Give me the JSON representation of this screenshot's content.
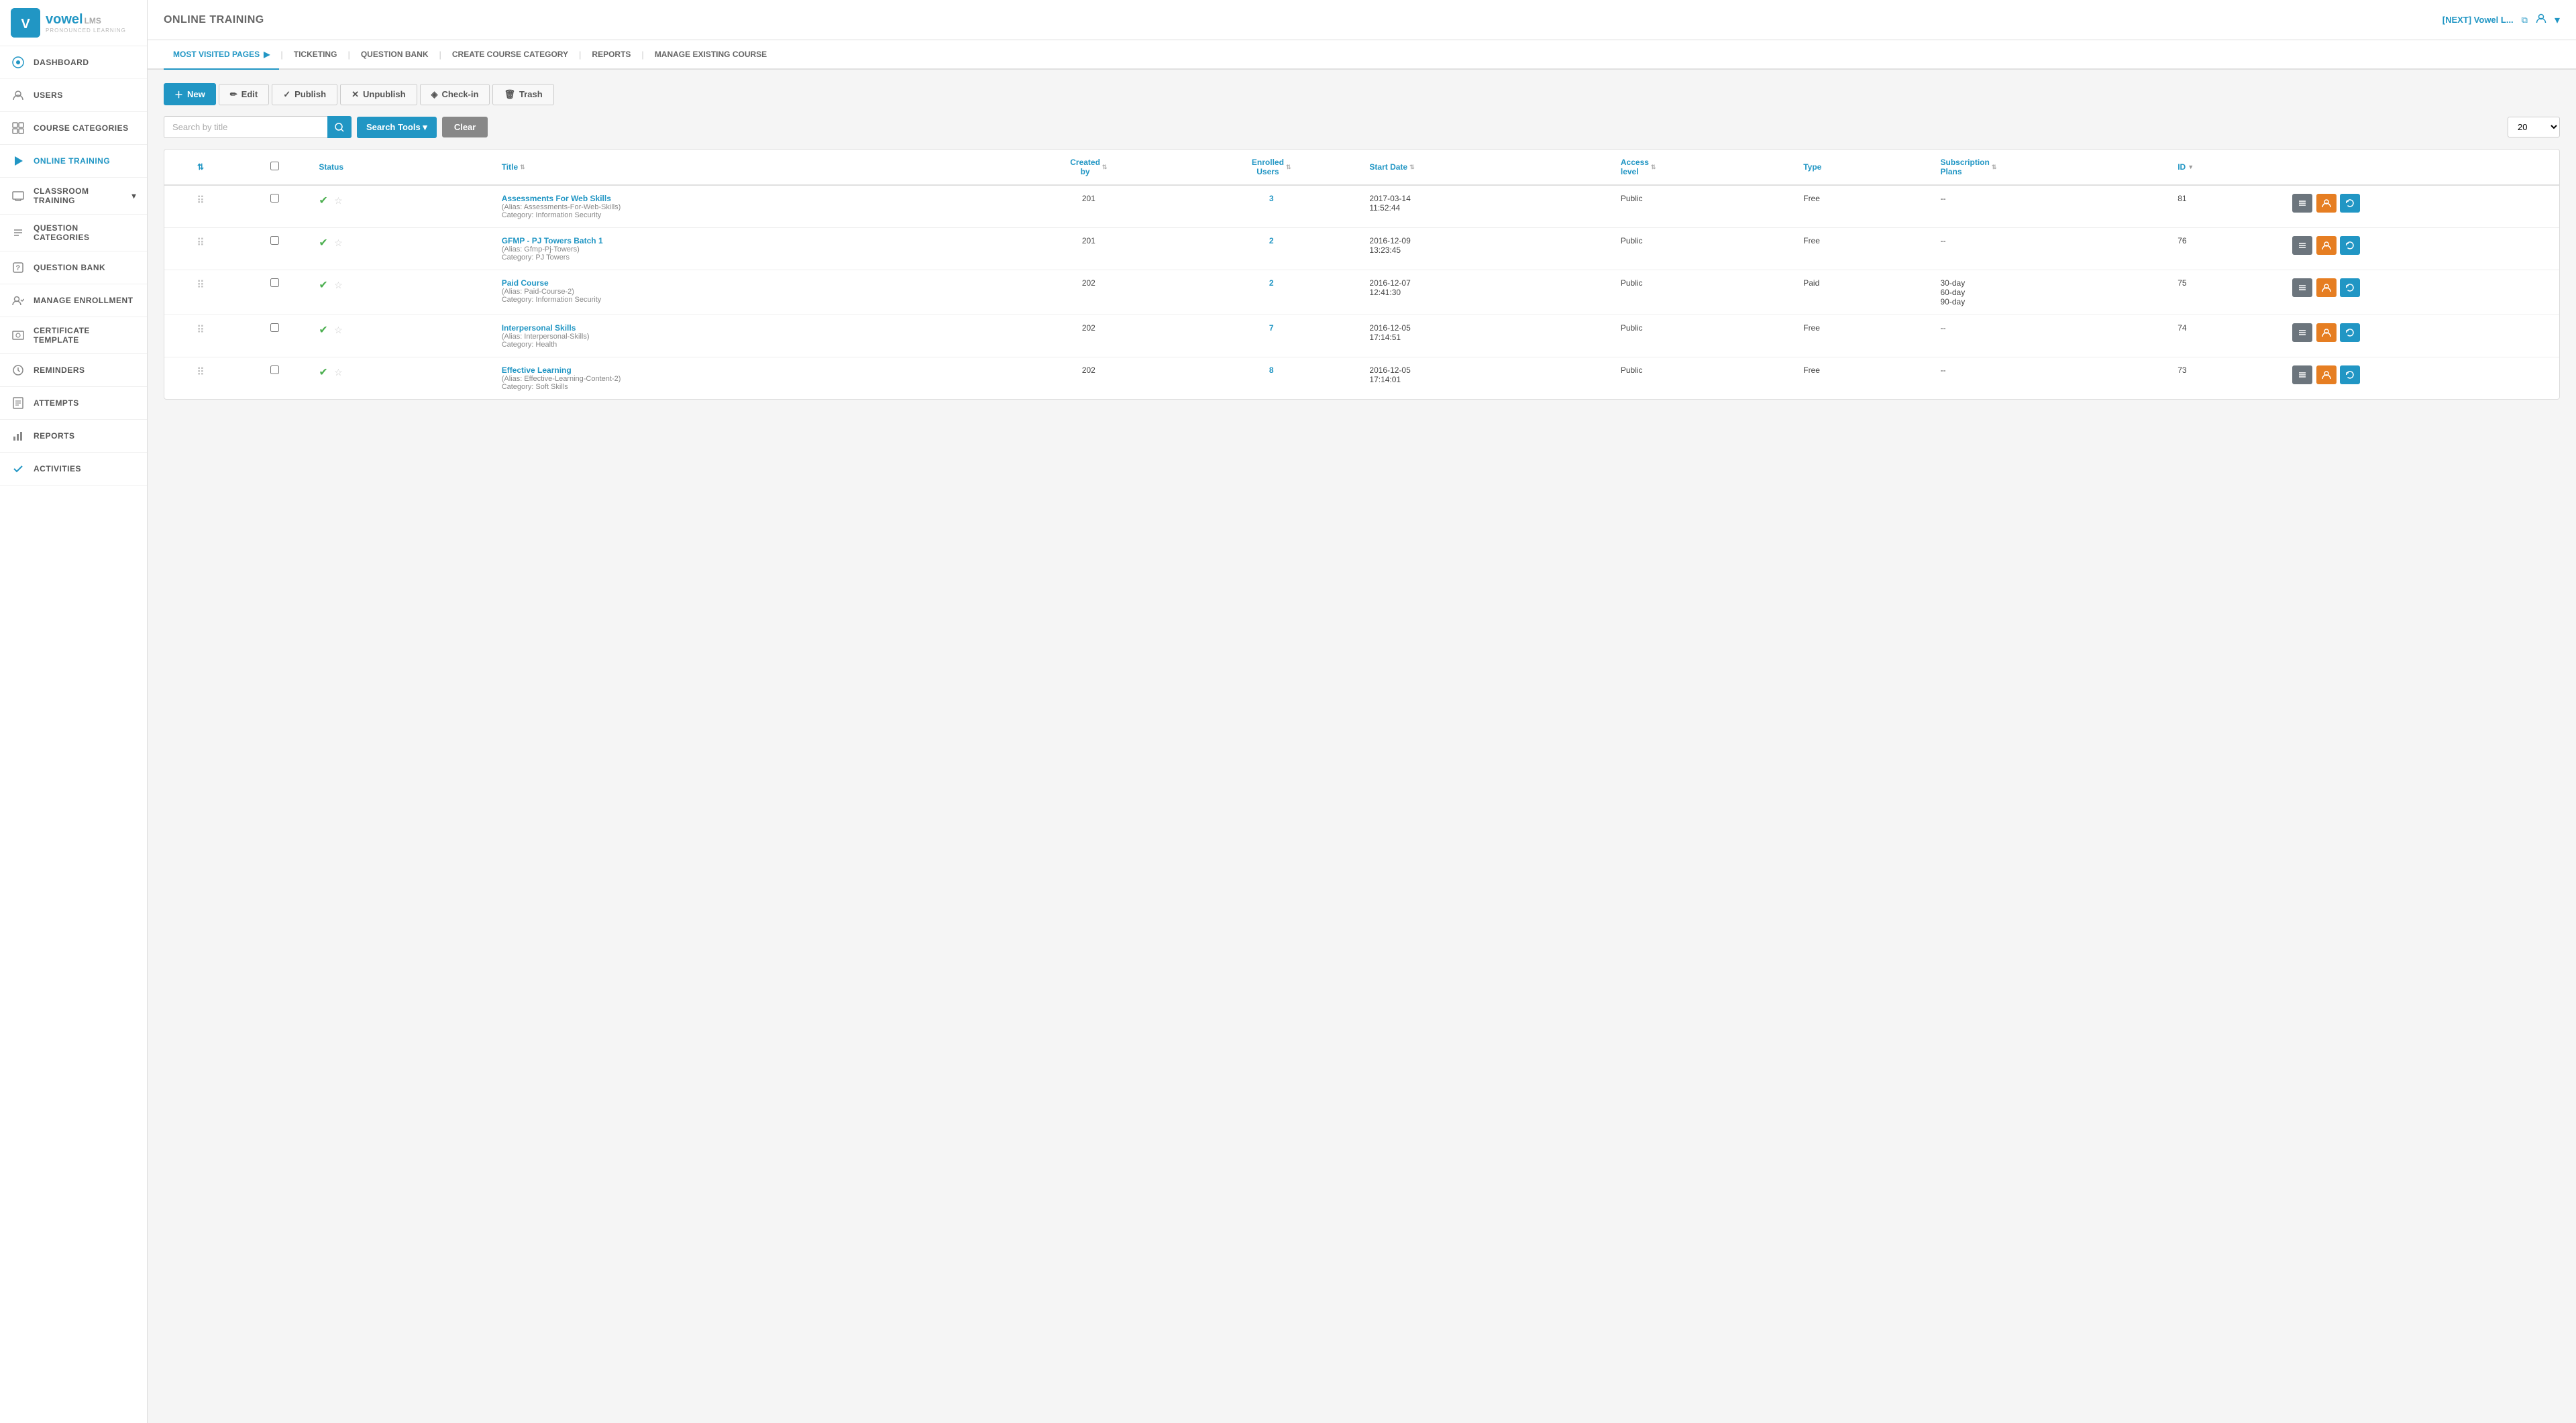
{
  "app": {
    "logo_text": "vowel",
    "logo_lms": "LMS",
    "logo_sub": "PRONOUNCED LEARNING",
    "logo_initial": "V"
  },
  "topbar": {
    "title": "ONLINE TRAINING",
    "user": "[NEXT] Vowel L...",
    "external_link": "⧉",
    "user_icon": "👤",
    "dropdown": "▾"
  },
  "navbar": {
    "items": [
      {
        "id": "most-visited",
        "label": "MOST VISITED PAGES",
        "active": true,
        "highlighted": true
      },
      {
        "id": "ticketing",
        "label": "TICKETING"
      },
      {
        "id": "question-bank",
        "label": "QUESTION BANK"
      },
      {
        "id": "create-course-category",
        "label": "CREATE COURSE CATEGORY"
      },
      {
        "id": "reports",
        "label": "REPORTS"
      },
      {
        "id": "manage-existing-course",
        "label": "MANAGE EXISTING COURSE"
      }
    ]
  },
  "sidebar": {
    "items": [
      {
        "id": "dashboard",
        "label": "DASHBOARD",
        "icon": "⊙"
      },
      {
        "id": "users",
        "label": "USERS",
        "icon": "👤"
      },
      {
        "id": "course-categories",
        "label": "COURSE CATEGORIES",
        "icon": "⊞"
      },
      {
        "id": "online-training",
        "label": "ONLINE TRAINING",
        "icon": "▶",
        "active": true
      },
      {
        "id": "classroom-training",
        "label": "CLASSROOM TRAINING",
        "icon": "🎓",
        "has_chevron": true
      },
      {
        "id": "question-categories",
        "label": "QUESTION CATEGORIES",
        "icon": "≡"
      },
      {
        "id": "question-bank",
        "label": "QUESTION BANK",
        "icon": "?"
      },
      {
        "id": "manage-enrollment",
        "label": "MANAGE ENROLLMENT",
        "icon": "👥"
      },
      {
        "id": "certificate-template",
        "label": "CERTIFICATE TEMPLATE",
        "icon": "🏅"
      },
      {
        "id": "reminders",
        "label": "REMINDERS",
        "icon": "🕐"
      },
      {
        "id": "attempts",
        "label": "ATTEMPTS",
        "icon": "📋"
      },
      {
        "id": "reports",
        "label": "REPORTS",
        "icon": "📊"
      },
      {
        "id": "activities",
        "label": "ACTIVITIES",
        "icon": "✔"
      }
    ]
  },
  "toolbar": {
    "new_label": "New",
    "edit_label": "Edit",
    "publish_label": "Publish",
    "unpublish_label": "Unpublish",
    "checkin_label": "Check-in",
    "trash_label": "Trash"
  },
  "search": {
    "placeholder": "Search by title",
    "search_tools_label": "Search Tools ▾",
    "clear_label": "Clear",
    "per_page": "20"
  },
  "table": {
    "columns": [
      "",
      "",
      "Status",
      "Title",
      "Created by",
      "Enrolled Users",
      "Start Date",
      "Access level",
      "Type",
      "Subscription Plans",
      "ID"
    ],
    "rows": [
      {
        "id": 81,
        "title": "Assessments For Web Skills",
        "alias": "Alias: Assessments-For-Web-Skills",
        "category": "Category: Information Security",
        "status": "published",
        "created_by": "201",
        "enrolled": "3",
        "start_date": "2017-03-14",
        "start_time": "11:52:44",
        "access_level": "Public",
        "type": "Free",
        "subscription_plans": "--"
      },
      {
        "id": 76,
        "title": "GFMP - PJ Towers Batch 1",
        "alias": "Alias: Gfmp-Pj-Towers",
        "category": "Category: PJ Towers",
        "status": "published",
        "created_by": "201",
        "enrolled": "2",
        "start_date": "2016-12-09",
        "start_time": "13:23:45",
        "access_level": "Public",
        "type": "Free",
        "subscription_plans": "--"
      },
      {
        "id": 75,
        "title": "Paid Course",
        "alias": "Alias: Paid-Course-2",
        "category": "Category: Information Security",
        "status": "published",
        "created_by": "202",
        "enrolled": "2",
        "start_date": "2016-12-07",
        "start_time": "12:41:30",
        "access_level": "Public",
        "type": "Paid",
        "subscription_plans": "30-day\n60-day\n90-day"
      },
      {
        "id": 74,
        "title": "Interpersonal Skills",
        "alias": "Alias: Interpersonal-Skills",
        "category": "Category: Health",
        "status": "published",
        "created_by": "202",
        "enrolled": "7",
        "start_date": "2016-12-05",
        "start_time": "17:14:51",
        "access_level": "Public",
        "type": "Free",
        "subscription_plans": "--"
      },
      {
        "id": 73,
        "title": "Effective Learning",
        "alias": "Alias: Effective-Learning-Content-2",
        "category": "Category: Soft Skills",
        "status": "published",
        "created_by": "202",
        "enrolled": "8",
        "start_date": "2016-12-05",
        "start_time": "17:14:01",
        "access_level": "Public",
        "type": "Free",
        "subscription_plans": "--"
      }
    ]
  },
  "colors": {
    "primary": "#2196c4",
    "success": "#4caf50",
    "warning": "#e67e22",
    "gray": "#6c757d"
  }
}
